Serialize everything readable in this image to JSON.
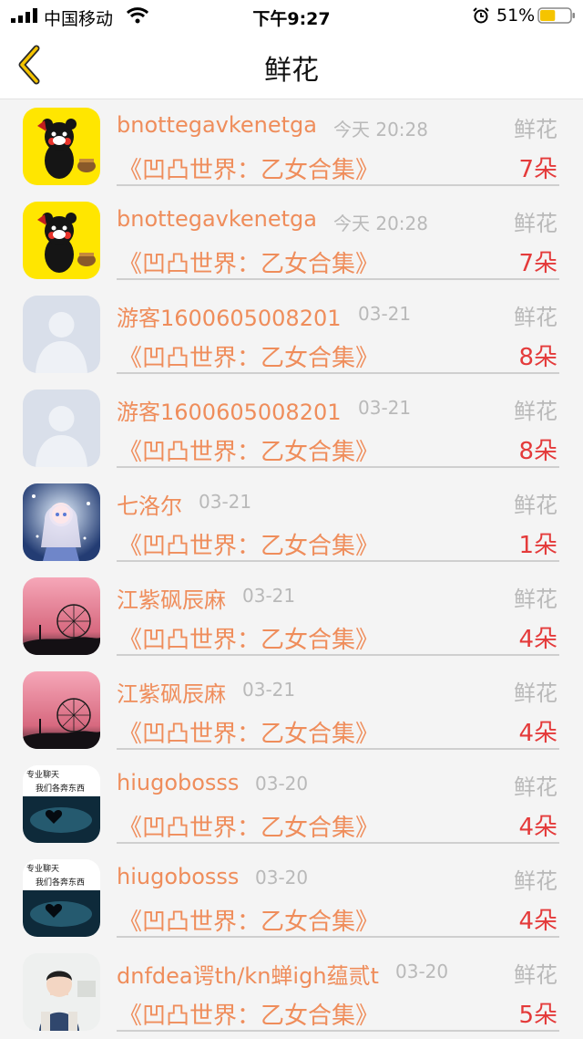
{
  "status_bar": {
    "carrier": "中国移动",
    "time": "下午9:27",
    "battery_percent": "51%",
    "battery_level": 0.51,
    "icons": [
      "signal-icon",
      "wifi-icon",
      "alarm-icon",
      "battery-icon"
    ]
  },
  "nav": {
    "title": "鲜花",
    "back_icon": "chevron-left-icon",
    "accent_color": "#e6b800"
  },
  "colors": {
    "name": "#ef8d5b",
    "count": "#e43a3a",
    "muted": "#b9b9b9"
  },
  "list": [
    {
      "avatar": "kumamon-bear",
      "name": "bnottegavkenetga",
      "date": "今天 20:28",
      "type": "鲜花",
      "book": "《凹凸世界：乙女合集》",
      "count": "7朵"
    },
    {
      "avatar": "kumamon-bear",
      "name": "bnottegavkenetga",
      "date": "今天 20:28",
      "type": "鲜花",
      "book": "《凹凸世界：乙女合集》",
      "count": "7朵"
    },
    {
      "avatar": "default-user",
      "name": "游客1600605008201",
      "date": "03-21",
      "type": "鲜花",
      "book": "《凹凸世界：乙女合集》",
      "count": "8朵"
    },
    {
      "avatar": "default-user",
      "name": "游客1600605008201",
      "date": "03-21",
      "type": "鲜花",
      "book": "《凹凸世界：乙女合集》",
      "count": "8朵"
    },
    {
      "avatar": "anime-girl",
      "name": "七洛尔",
      "date": "03-21",
      "type": "鲜花",
      "book": "《凹凸世界：乙女合集》",
      "count": "1朵"
    },
    {
      "avatar": "pink-ferris-wheel",
      "name": "江紫砜辰麻",
      "date": "03-21",
      "type": "鲜花",
      "book": "《凹凸世界：乙女合集》",
      "count": "4朵"
    },
    {
      "avatar": "pink-ferris-wheel",
      "name": "江紫砜辰麻",
      "date": "03-21",
      "type": "鲜花",
      "book": "《凹凸世界：乙女合集》",
      "count": "4朵"
    },
    {
      "avatar": "dark-heart",
      "avatar_text": [
        "专业聊天",
        "我们各奔东西"
      ],
      "name": "hiugobosss",
      "date": "03-20",
      "type": "鲜花",
      "book": "《凹凸世界：乙女合集》",
      "count": "4朵"
    },
    {
      "avatar": "dark-heart",
      "avatar_text": [
        "专业聊天",
        "我们各奔东西"
      ],
      "name": "hiugobosss",
      "date": "03-20",
      "type": "鲜花",
      "book": "《凹凸世界：乙女合集》",
      "count": "4朵"
    },
    {
      "avatar": "boy-photo",
      "name": "dnfdea谔th/kn蝉igh蕴贰t",
      "date": "03-20",
      "type": "鲜花",
      "book": "《凹凸世界：乙女合集》",
      "count": "5朵"
    }
  ]
}
